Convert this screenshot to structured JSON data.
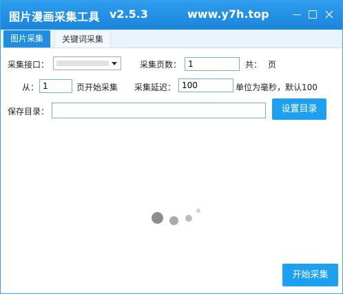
{
  "window": {
    "title": "图片漫画采集工具",
    "version": "v2.5.3",
    "url": "www.y7h.top"
  },
  "tabs": [
    {
      "label": "图片采集",
      "active": true
    },
    {
      "label": "关键词采集",
      "active": false
    }
  ],
  "form": {
    "interface_label": "采集接口：",
    "interface_value": "",
    "pages_label": "采集页数：",
    "pages_value": "1",
    "total_prefix": "共：",
    "total_suffix": "页",
    "from_label": "从：",
    "from_value": "1",
    "from_suffix": "页开始采集",
    "delay_label": "采集延迟：",
    "delay_value": "100",
    "delay_hint": "单位为毫秒，默认100",
    "dir_label": "保存目录：",
    "dir_value": "",
    "set_dir_button": "设置目录",
    "start_button": "开始采集"
  },
  "colors": {
    "accent": "#1ea0f0",
    "titlebar": "#1a86dc"
  },
  "icons": {
    "minimize": "minimize-icon",
    "maximize": "maximize-icon",
    "close": "close-icon",
    "dropdown": "chevron-down-icon",
    "loading": "loading-spinner-icon"
  }
}
